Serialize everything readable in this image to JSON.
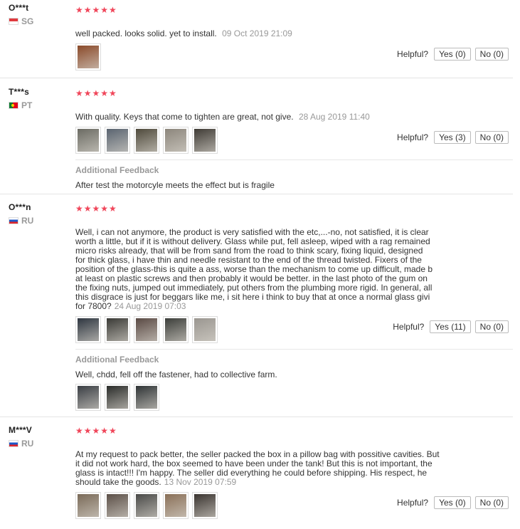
{
  "reviews": [
    {
      "user": "O***t",
      "country": "SG",
      "stars": "★★★★★",
      "text": "well packed. looks solid. yet to install.",
      "date": "09 Oct 2019 21:09",
      "helpful_label": "Helpful?",
      "yes_label": "Yes (0)",
      "no_label": "No (0)",
      "photo_colors": [
        "#8a4a2a"
      ]
    },
    {
      "user": "T***s",
      "country": "PT",
      "stars": "★★★★★",
      "text": "With quality. Keys that come to tighten are great, not give.",
      "date": "28 Aug 2019 11:40",
      "helpful_label": "Helpful?",
      "yes_label": "Yes (3)",
      "no_label": "No (0)",
      "photo_colors": [
        "#6b6b63",
        "#5a6470",
        "#4f4a3c",
        "#8c867c",
        "#3f3b35"
      ],
      "feedback_title": "Additional Feedback",
      "feedback_text": "After test the motorcyle meets the effect but is fragile"
    },
    {
      "user": "O***n",
      "country": "RU",
      "stars": "★★★★★",
      "text_lines": [
        "Well, i can not anymore, the product is very satisfied with the etc,...-no, not satisfied, it is clear",
        "worth a little, but if it is without delivery. Glass while put, fell asleep, wiped with a rag remained",
        "micro risks already, that will be from sand from the road to think scary, fixing liquid, designed",
        "for thick glass, i have thin and needle resistant to the end of the thread twisted. Fixers of the",
        "position of the glass-this is quite a ass, worse than the mechanism to come up difficult, made b",
        "at least on plastic screws and then probably it would be better. in the last photo of the gum on",
        "the fixing nuts, jumped out immediately, put others from the plumbing more rigid. In general, all",
        "this disgrace is just for beggars like me, i sit here i think to buy that at once a normal glass givi",
        "for 7800?"
      ],
      "date": "24 Aug 2019 07:03",
      "helpful_label": "Helpful?",
      "yes_label": "Yes (11)",
      "no_label": "No (0)",
      "photo_colors": [
        "#2e3640",
        "#3a3a36",
        "#5a4a44",
        "#3c3e3a",
        "#9a9690"
      ],
      "feedback_title": "Additional Feedback",
      "feedback_text": "Well, chdd, fell off the fastener, had to collective farm.",
      "feedback_photo_colors": [
        "#3a3e44",
        "#2a2c2a",
        "#2f3436"
      ]
    },
    {
      "user": "M***V",
      "country": "RU",
      "stars": "★★★★★",
      "text_lines": [
        "At my request to pack better, the seller packed the box in a pillow bag with possitive cavities. But",
        "it did not work hard, the box seemed to have been under the tank! But this is not important, the",
        "glass is intact!!! I'm happy. The seller did everything he could before shipping. His respect, he",
        "should take the goods."
      ],
      "date": "13 Nov 2019 07:59",
      "helpful_label": "Helpful?",
      "yes_label": "Yes (0)",
      "no_label": "No (0)",
      "photo_colors": [
        "#7a6a58",
        "#5c5048",
        "#4a4a48",
        "#8a7058",
        "#3a3430"
      ]
    }
  ]
}
